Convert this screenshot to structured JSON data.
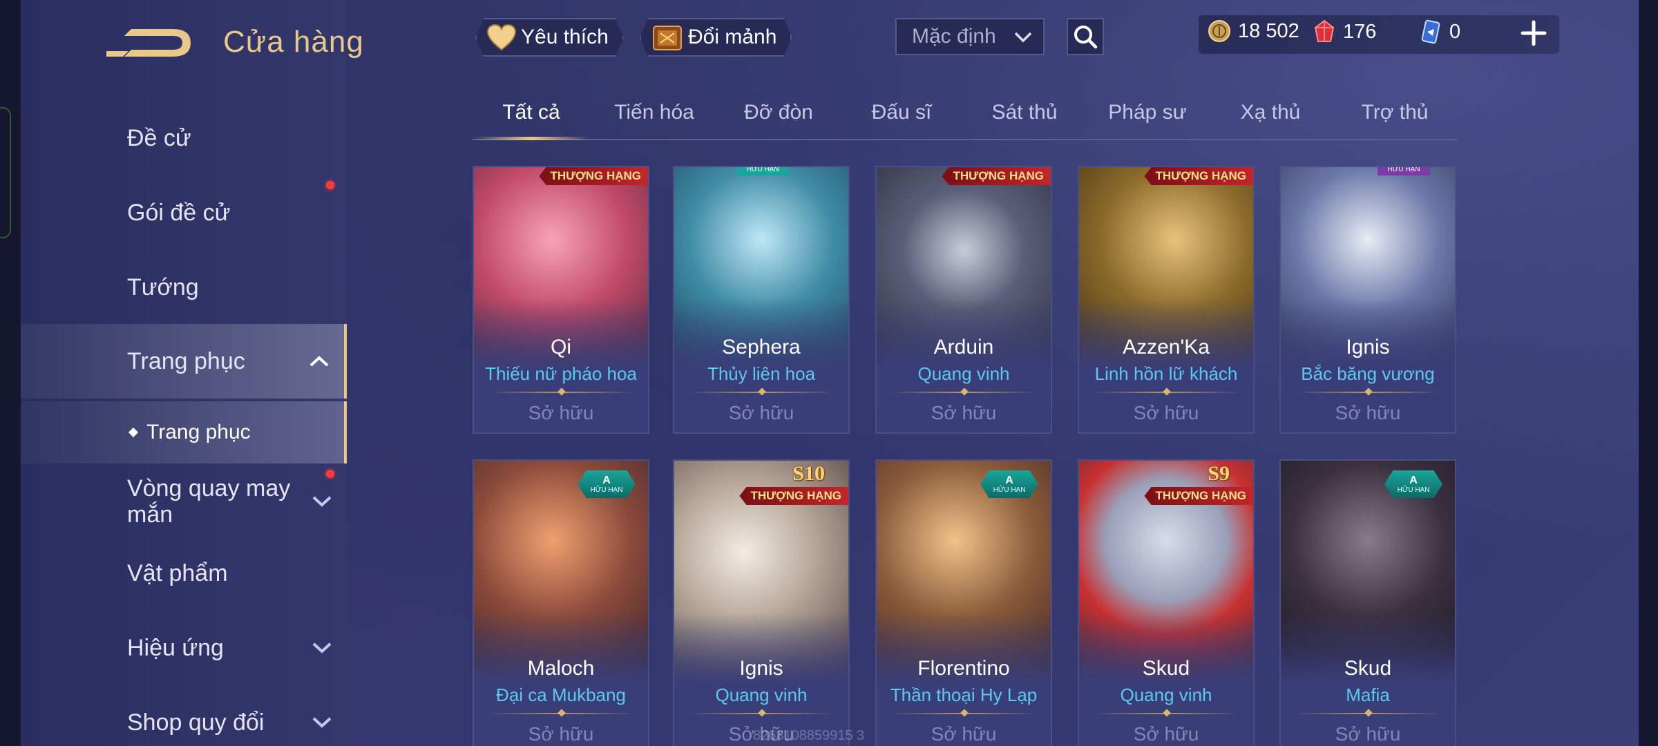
{
  "header": {
    "title": "Cửa hàng",
    "favorites_label": "Yêu thích",
    "exchange_label": "Đổi mảnh",
    "sort_value": "Mặc định"
  },
  "currency": {
    "gold": "18 502",
    "ruby": "176",
    "voucher": "0"
  },
  "sidebar": {
    "items": [
      {
        "label": "Đề cử"
      },
      {
        "label": "Gói đề cử"
      },
      {
        "label": "Tướng"
      },
      {
        "label": "Trang phục"
      },
      {
        "label": "Vòng quay may mắn"
      },
      {
        "label": "Vật phẩm"
      },
      {
        "label": "Hiệu ứng"
      },
      {
        "label": "Shop quy đổi"
      }
    ],
    "subitem": "Trang phục"
  },
  "tabs": [
    "Tất cả",
    "Tiến hóa",
    "Đỡ đòn",
    "Đấu sĩ",
    "Sát thủ",
    "Pháp sư",
    "Xạ thủ",
    "Trợ thủ"
  ],
  "cards": [
    {
      "hero": "Qi",
      "skin": "Thiếu nữ pháo hoa",
      "status": "Sở hữu",
      "badge": "THƯỢNG HẠNG",
      "art_color": "#c24a6a"
    },
    {
      "hero": "Sephera",
      "skin": "Thủy liên hoa",
      "status": "Sở hữu",
      "badge_top": "HỮU HẠN",
      "art_color": "#3f8ca6"
    },
    {
      "hero": "Arduin",
      "skin": "Quang vinh",
      "status": "Sở hữu",
      "badge": "THƯỢNG HẠNG",
      "art_color": "#5a5f78"
    },
    {
      "hero": "Azzen'Ka",
      "skin": "Linh hồn lữ khách",
      "status": "Sở hữu",
      "badge": "THƯỢNG HẠNG",
      "art_color": "#8a6a2a"
    },
    {
      "hero": "Ignis",
      "skin": "Bắc băng vương",
      "status": "Sở hữu",
      "badge_top": "HỮU HẠN",
      "art_color": "#6a78a8"
    },
    {
      "hero": "Maloch",
      "skin": "Đại ca Mukbang",
      "status": "Sở hữu",
      "tier": "A",
      "tier_text": "HỮU HẠN",
      "art_color": "#8a4a3a"
    },
    {
      "hero": "Ignis",
      "skin": "Quang vinh",
      "status": "Sở hữu",
      "season": "S10",
      "badge": "THƯỢNG HẠNG",
      "art_color": "#b8a89a"
    },
    {
      "hero": "Florentino",
      "skin": "Thần thoại Hy Lạp",
      "status": "Sở hữu",
      "tier": "A",
      "tier_text": "HỮU HẠN",
      "art_color": "#8a5a3a"
    },
    {
      "hero": "Skud",
      "skin": "Quang vinh",
      "status": "Sở hữu",
      "season": "S9",
      "badge": "THƯỢNG HẠNG",
      "art_color": "#9aa0b8"
    },
    {
      "hero": "Skud",
      "skin": "Mafia",
      "status": "Sở hữu",
      "tier": "A",
      "tier_text": "HỮU HẠN",
      "art_color": "#3a3040"
    }
  ],
  "watermark": "8268108859915 3",
  "colors": {
    "accent_gold": "#e8c98a",
    "skin_name": "#5cc8f0",
    "badge_red": "#c2262b",
    "badge_teal": "#1aa59a"
  }
}
